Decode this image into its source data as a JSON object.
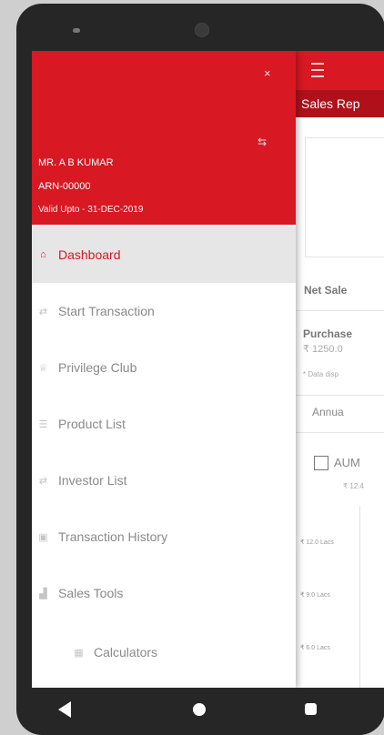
{
  "drawer": {
    "user_name": "MR. A B KUMAR",
    "arn": "ARN-00000",
    "valid_upto": "Valid Upto - 31-DEC-2019",
    "close_icon": "×",
    "swap_icon": "⇆",
    "items": [
      {
        "label": "Dashboard",
        "icon": "home-icon",
        "glyph": "⌂",
        "active": true
      },
      {
        "label": "Start Transaction",
        "icon": "transaction-icon",
        "glyph": "⇄"
      },
      {
        "label": "Privilege Club",
        "icon": "trophy-icon",
        "glyph": "♕"
      },
      {
        "label": "Product List",
        "icon": "list-icon",
        "glyph": "☰"
      },
      {
        "label": "Investor List",
        "icon": "investor-icon",
        "glyph": "⇄"
      },
      {
        "label": "Transaction History",
        "icon": "history-icon",
        "glyph": "▣"
      },
      {
        "label": "Sales Tools",
        "icon": "chart-icon",
        "glyph": "▟"
      },
      {
        "label": "Calculators",
        "icon": "calculator-icon",
        "glyph": "▦"
      }
    ]
  },
  "app": {
    "title": "Sales Rep",
    "net_sales": "Net Sale",
    "purchase_label": "Purchase",
    "purchase_value": "₹ 1250.0",
    "note": "* Data disp",
    "tab_annual": "Annua",
    "aum_label": "AUM",
    "aum_value": "₹ 12.4",
    "y_labels": [
      "₹ 12.0 Lacs",
      "₹ 9.0 Lacs",
      "₹ 6.0 Lacs"
    ]
  },
  "colors": {
    "brand_red": "#d81822",
    "active_bg": "#e6e6e6"
  },
  "navbar": {
    "back": "back-icon",
    "home": "home-circle-icon",
    "recent": "recent-apps-icon"
  }
}
